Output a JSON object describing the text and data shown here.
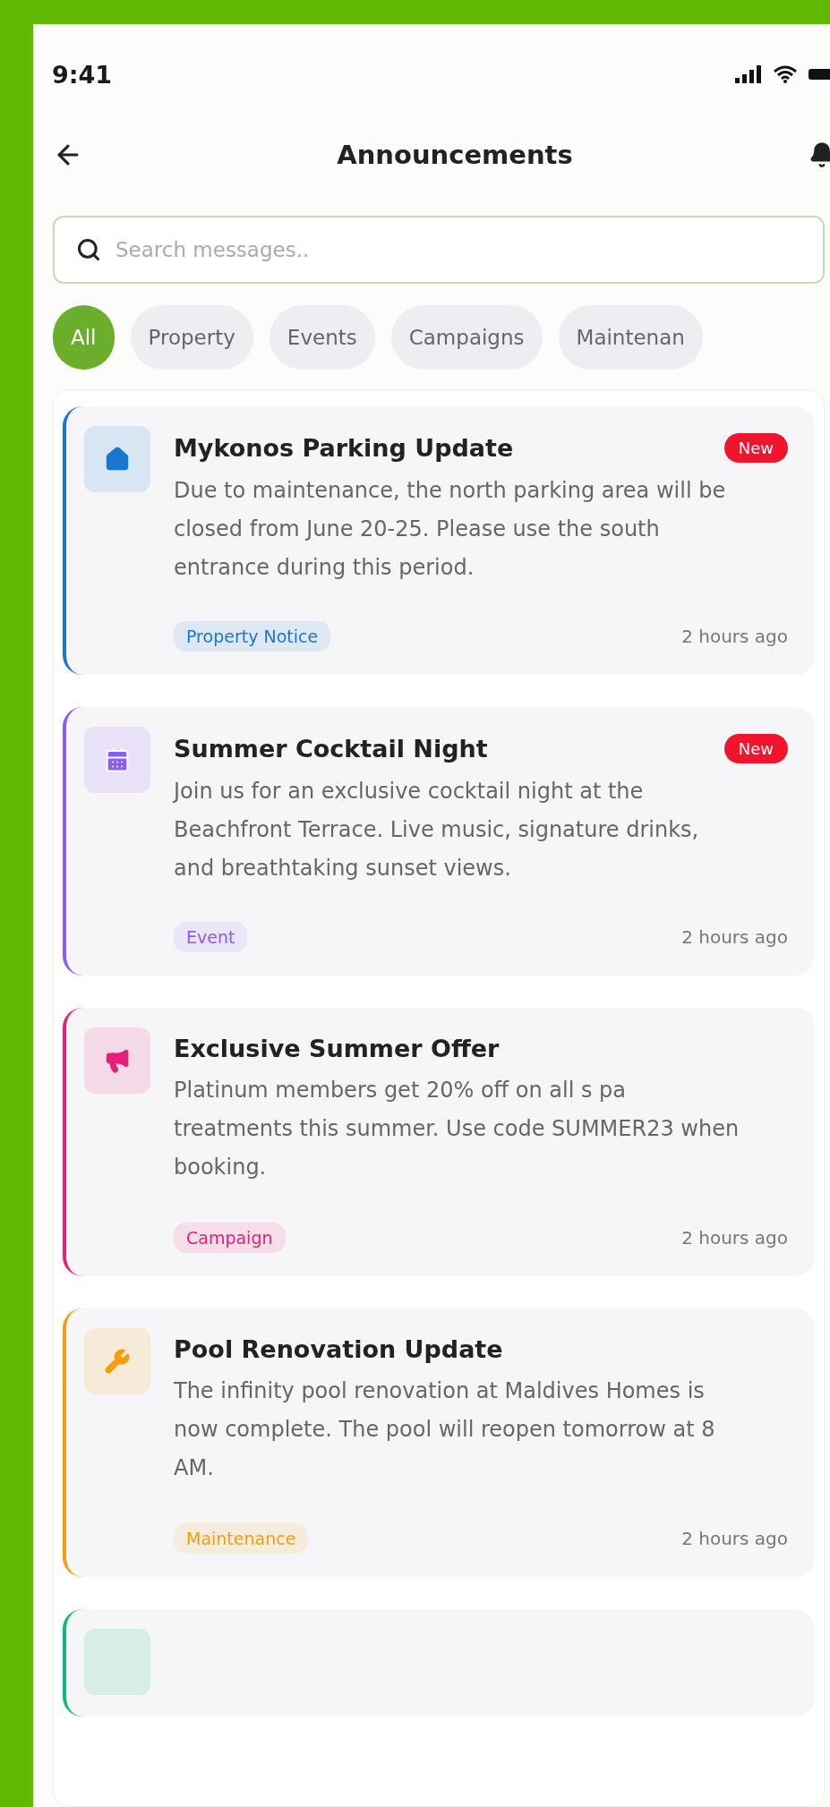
{
  "status_bar": {
    "time": "9:41"
  },
  "header": {
    "title": "Announcements"
  },
  "search": {
    "placeholder": "Search messages.."
  },
  "filters": [
    {
      "label": "All",
      "selected": true
    },
    {
      "label": "Property",
      "selected": false
    },
    {
      "label": "Events",
      "selected": false
    },
    {
      "label": "Campaigns",
      "selected": false
    },
    {
      "label": "Maintenan",
      "selected": false
    }
  ],
  "announcements": [
    {
      "kind": "property",
      "color": "#1976d2",
      "title": "Mykonos Parking Update",
      "badge": "New",
      "body": "Due to maintenance, the north parking area will be closed from June 20-25. Please use the south entrance during this period.",
      "tag": "Property Notice",
      "time": "2 hours ago"
    },
    {
      "kind": "event",
      "color": "#8b5cf6",
      "title": "Summer Cocktail Night",
      "badge": "New",
      "body": "Join us for an exclusive cocktail night at the Beachfront Terrace. Live music, signature drinks, and breathtaking sunset views.",
      "tag": "Event",
      "time": "2 hours ago"
    },
    {
      "kind": "campaign",
      "color": "#e91e7a",
      "title": "Exclusive Summer Offer",
      "body": "Platinum members get 20% off on all s pa treatments this summer. Use code SUMMER23 when booking.",
      "tag": "Campaign",
      "time": "2 hours ago"
    },
    {
      "kind": "maintenance",
      "color": "#f59e0b",
      "title": "Pool Renovation Update",
      "body": "The infinity pool renovation at Maldives Homes is now complete. The pool will reopen tomorrow at 8 AM.",
      "tag": "Maintenance",
      "time": "2 hours ago"
    }
  ],
  "partial_card": {
    "color": "#10b981"
  }
}
